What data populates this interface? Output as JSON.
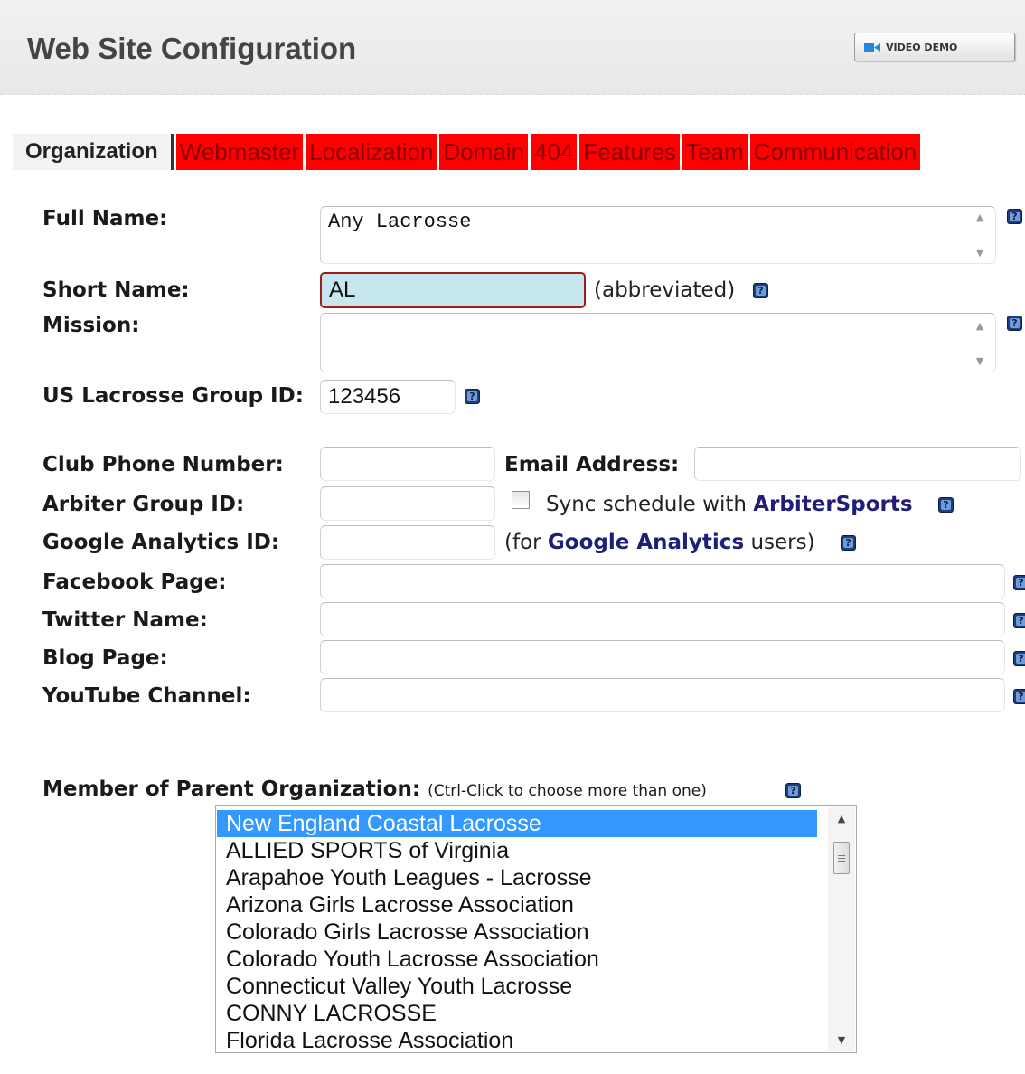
{
  "header": {
    "title": "Web Site Configuration",
    "video_demo_label": "VIDEO DEMO"
  },
  "tabs": [
    {
      "label": "Organization",
      "active": true
    },
    {
      "label": "Webmaster",
      "active": false
    },
    {
      "label": "Localization",
      "active": false
    },
    {
      "label": "Domain",
      "active": false
    },
    {
      "label": "404",
      "active": false
    },
    {
      "label": "Features",
      "active": false
    },
    {
      "label": "Team",
      "active": false
    },
    {
      "label": "Communication",
      "active": false
    }
  ],
  "form": {
    "full_name": {
      "label": "Full Name:",
      "value": "Any Lacrosse"
    },
    "short_name": {
      "label": "Short Name:",
      "value": "AL",
      "note": "(abbreviated)"
    },
    "mission": {
      "label": "Mission:",
      "value": ""
    },
    "group_id": {
      "label": "US Lacrosse Group ID:",
      "value": "123456"
    },
    "club_phone": {
      "label": "Club Phone Number:",
      "value": ""
    },
    "email": {
      "label": "Email Address:",
      "value": ""
    },
    "arbiter_id": {
      "label": "Arbiter Group ID:",
      "value": ""
    },
    "sync": {
      "label_prefix": "Sync schedule with ",
      "link": "ArbiterSports",
      "checked": false
    },
    "ga_id": {
      "label": "Google Analytics ID:",
      "value": ""
    },
    "ga_note": {
      "prefix": "(for ",
      "link": "Google Analytics",
      "suffix": " users)"
    },
    "facebook": {
      "label": "Facebook Page:",
      "value": ""
    },
    "twitter": {
      "label": "Twitter Name:",
      "value": ""
    },
    "blog": {
      "label": "Blog Page:",
      "value": ""
    },
    "youtube": {
      "label": "YouTube Channel:",
      "value": ""
    }
  },
  "parent_org": {
    "label": "Member of Parent Organization:",
    "hint": "(Ctrl-Click to choose more than one)",
    "options": [
      {
        "label": "New England Coastal Lacrosse",
        "selected": true
      },
      {
        "label": "ALLIED SPORTS of Virginia",
        "selected": false
      },
      {
        "label": "Arapahoe Youth Leagues - Lacrosse",
        "selected": false
      },
      {
        "label": "Arizona Girls Lacrosse Association",
        "selected": false
      },
      {
        "label": "Colorado Girls Lacrosse Association",
        "selected": false
      },
      {
        "label": "Colorado Youth Lacrosse Association",
        "selected": false
      },
      {
        "label": "Connecticut Valley Youth Lacrosse",
        "selected": false
      },
      {
        "label": "CONNY LACROSSE",
        "selected": false
      },
      {
        "label": "Florida Lacrosse Association",
        "selected": false
      }
    ]
  },
  "colors": {
    "tab_red": "#ff0000",
    "tab_text": "#8a0000",
    "link": "#1f1f7a",
    "selection": "#3399ff",
    "short_name_bg": "#c7e7ef"
  }
}
